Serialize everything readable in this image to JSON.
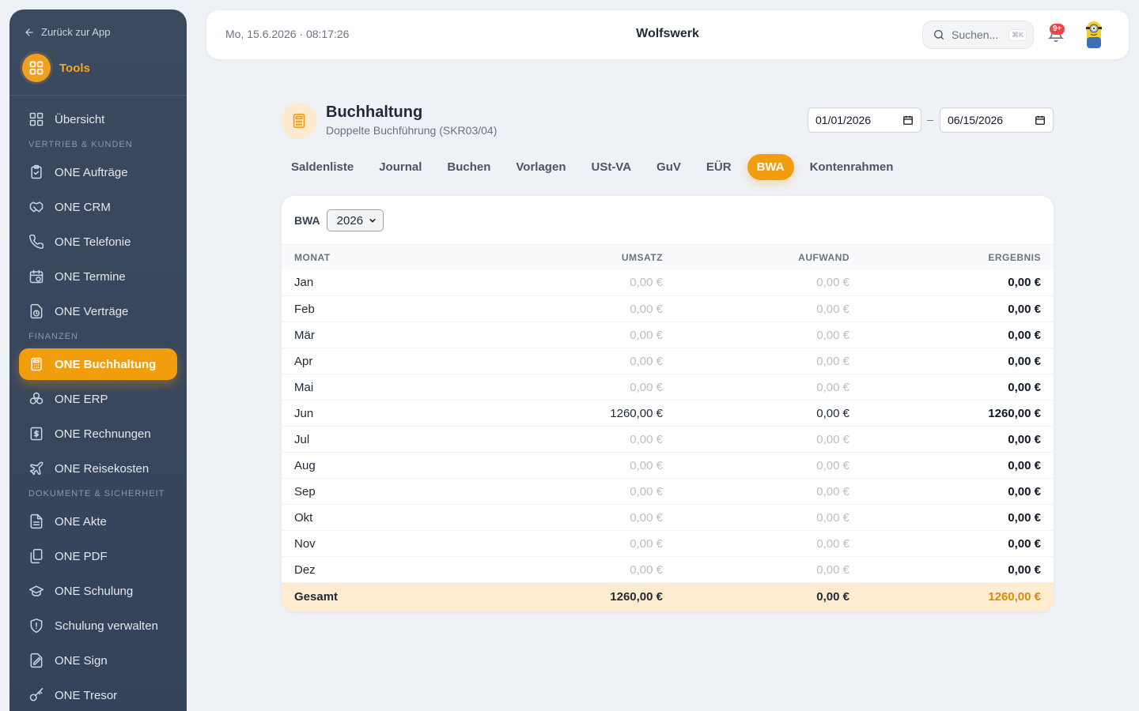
{
  "sidebar": {
    "back_label": "Zurück zur App",
    "tools_label": "Tools",
    "items": [
      {
        "type": "item",
        "label": "Übersicht",
        "icon": "grid-icon"
      },
      {
        "type": "section",
        "label": "VERTRIEB & KUNDEN"
      },
      {
        "type": "item",
        "label": "ONE Aufträge",
        "icon": "clipboard-check-icon"
      },
      {
        "type": "item",
        "label": "ONE CRM",
        "icon": "handshake-icon"
      },
      {
        "type": "item",
        "label": "ONE Telefonie",
        "icon": "phone-icon"
      },
      {
        "type": "item",
        "label": "ONE Termine",
        "icon": "calendar-clock-icon"
      },
      {
        "type": "item",
        "label": "ONE Verträge",
        "icon": "file-clock-icon"
      },
      {
        "type": "section",
        "label": "FINANZEN"
      },
      {
        "type": "item",
        "label": "ONE Buchhaltung",
        "icon": "calculator-icon",
        "active": true
      },
      {
        "type": "item",
        "label": "ONE ERP",
        "icon": "boxes-icon"
      },
      {
        "type": "item",
        "label": "ONE Rechnungen",
        "icon": "receipt-icon"
      },
      {
        "type": "item",
        "label": "ONE Reisekosten",
        "icon": "plane-icon"
      },
      {
        "type": "section",
        "label": "DOKUMENTE & SICHERHEIT"
      },
      {
        "type": "item",
        "label": "ONE Akte",
        "icon": "document-icon"
      },
      {
        "type": "item",
        "label": "ONE PDF",
        "icon": "files-icon"
      },
      {
        "type": "item",
        "label": "ONE Schulung",
        "icon": "graduation-cap-icon"
      },
      {
        "type": "item",
        "label": "Schulung verwalten",
        "icon": "shield-icon"
      },
      {
        "type": "item",
        "label": "ONE Sign",
        "icon": "signature-icon"
      },
      {
        "type": "item",
        "label": "ONE Tresor",
        "icon": "key-icon"
      }
    ]
  },
  "topbar": {
    "datetime": "Mo, 15.6.2026 · 08:17:26",
    "company": "Wolfswerk",
    "search_placeholder": "Suchen...",
    "search_shortcut": "⌘K",
    "notifications_badge": "9+"
  },
  "page": {
    "title": "Buchhaltung",
    "subtitle": "Doppelte Buchführung (SKR03/04)",
    "date_from": "01/01/2026",
    "date_separator": "–",
    "date_to": "06/15/2026"
  },
  "tabs": [
    {
      "label": "Saldenliste"
    },
    {
      "label": "Journal"
    },
    {
      "label": "Buchen"
    },
    {
      "label": "Vorlagen"
    },
    {
      "label": "USt-VA"
    },
    {
      "label": "GuV"
    },
    {
      "label": "EÜR"
    },
    {
      "label": "BWA",
      "active": true
    },
    {
      "label": "Kontenrahmen"
    }
  ],
  "bwa": {
    "label": "BWA",
    "year": "2026",
    "columns": [
      "MONAT",
      "UMSATZ",
      "AUFWAND",
      "ERGEBNIS"
    ],
    "rows": [
      {
        "month": "Jan",
        "umsatz": "0,00 €",
        "aufwand": "0,00 €",
        "ergebnis": "0,00 €",
        "muted": true
      },
      {
        "month": "Feb",
        "umsatz": "0,00 €",
        "aufwand": "0,00 €",
        "ergebnis": "0,00 €",
        "muted": true
      },
      {
        "month": "Mär",
        "umsatz": "0,00 €",
        "aufwand": "0,00 €",
        "ergebnis": "0,00 €",
        "muted": true
      },
      {
        "month": "Apr",
        "umsatz": "0,00 €",
        "aufwand": "0,00 €",
        "ergebnis": "0,00 €",
        "muted": true
      },
      {
        "month": "Mai",
        "umsatz": "0,00 €",
        "aufwand": "0,00 €",
        "ergebnis": "0,00 €",
        "muted": true
      },
      {
        "month": "Jun",
        "umsatz": "1260,00 €",
        "aufwand": "0,00 €",
        "ergebnis": "1260,00 €",
        "muted": false
      },
      {
        "month": "Jul",
        "umsatz": "0,00 €",
        "aufwand": "0,00 €",
        "ergebnis": "0,00 €",
        "muted": true
      },
      {
        "month": "Aug",
        "umsatz": "0,00 €",
        "aufwand": "0,00 €",
        "ergebnis": "0,00 €",
        "muted": true
      },
      {
        "month": "Sep",
        "umsatz": "0,00 €",
        "aufwand": "0,00 €",
        "ergebnis": "0,00 €",
        "muted": true
      },
      {
        "month": "Okt",
        "umsatz": "0,00 €",
        "aufwand": "0,00 €",
        "ergebnis": "0,00 €",
        "muted": true
      },
      {
        "month": "Nov",
        "umsatz": "0,00 €",
        "aufwand": "0,00 €",
        "ergebnis": "0,00 €",
        "muted": true
      },
      {
        "month": "Dez",
        "umsatz": "0,00 €",
        "aufwand": "0,00 €",
        "ergebnis": "0,00 €",
        "muted": true
      }
    ],
    "total": {
      "label": "Gesamt",
      "umsatz": "1260,00 €",
      "aufwand": "0,00 €",
      "ergebnis": "1260,00 €"
    }
  },
  "colors": {
    "accent": "#f29d0e",
    "sidebar_bg": "#3b4a5f",
    "total_row_bg": "#fdecd0",
    "total_result": "#d98a0a"
  }
}
